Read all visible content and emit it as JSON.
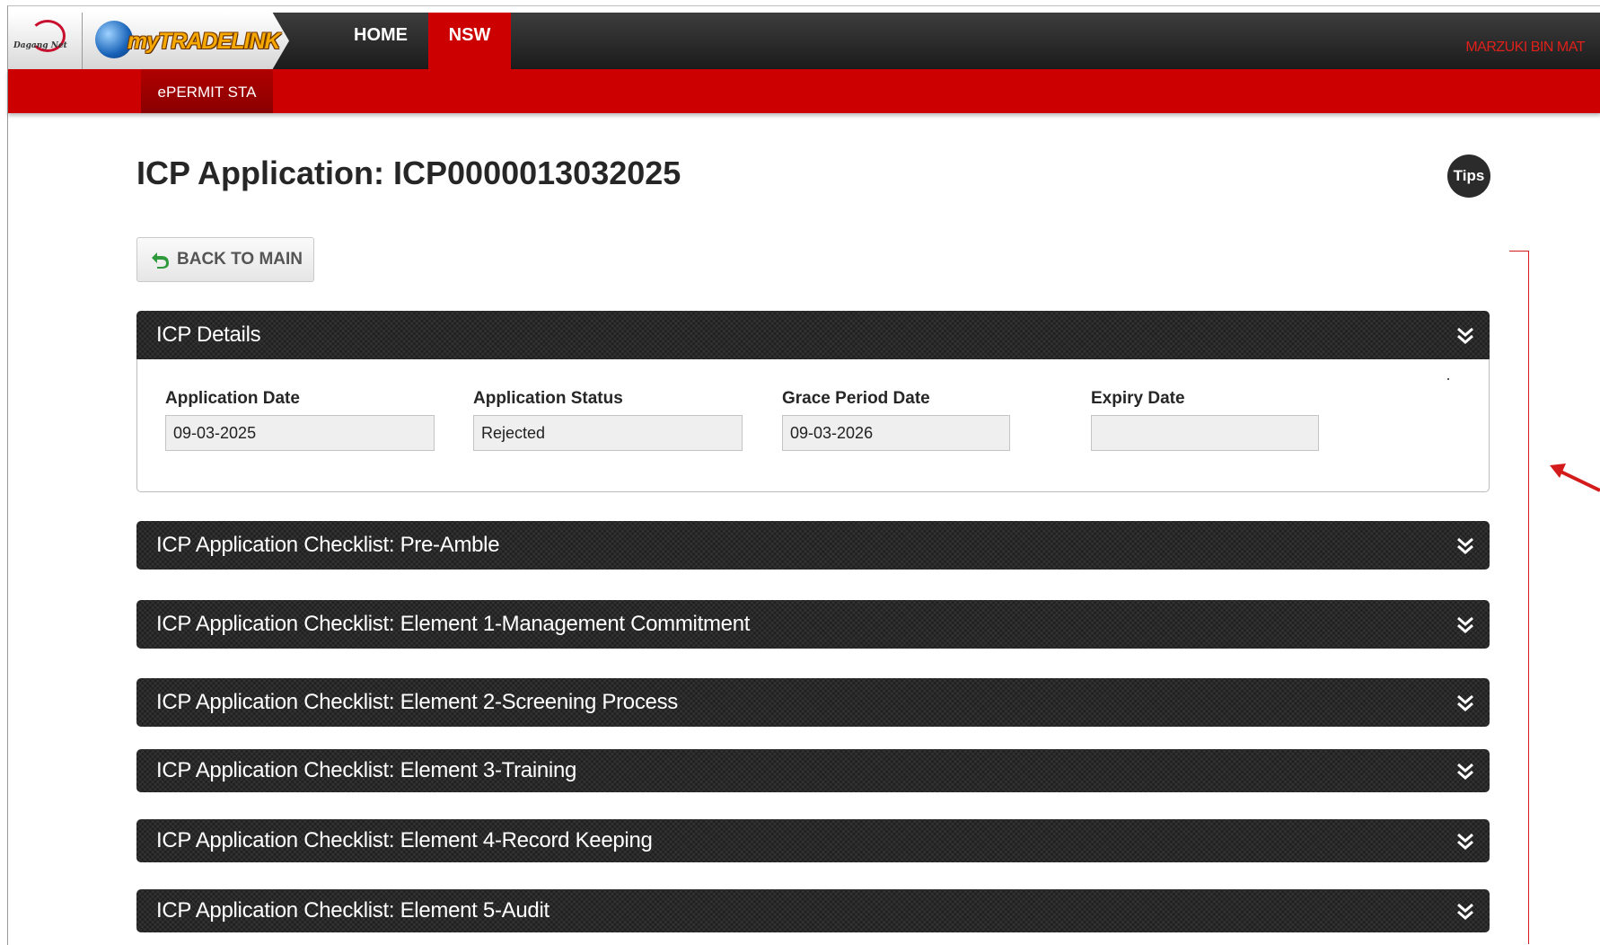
{
  "header": {
    "logo1_text": "Dagang Net",
    "brand": "myTRADELINK",
    "nav": [
      "HOME",
      "NSW"
    ],
    "user": "MARZUKI BIN MAT",
    "subtab": "ePERMIT STA"
  },
  "page": {
    "title": "ICP Application: ICP0000013032025",
    "tips_label": "Tips",
    "back_label": "BACK TO MAIN"
  },
  "details": {
    "header": "ICP Details",
    "fields": [
      {
        "label": "Application Date",
        "value": "09-03-2025"
      },
      {
        "label": "Application Status",
        "value": "Rejected"
      },
      {
        "label": "Grace Period Date",
        "value": "09-03-2026"
      },
      {
        "label": "Expiry Date",
        "value": ""
      }
    ]
  },
  "sections": [
    "ICP Application Checklist: Pre-Amble",
    "ICP Application Checklist: Element 1-Management Commitment",
    "ICP Application Checklist: Element 2-Screening Process",
    "ICP Application Checklist: Element 3-Training",
    "ICP Application Checklist: Element 4-Record Keeping",
    "ICP Application Checklist: Element 5-Audit"
  ],
  "colors": {
    "brand_red": "#cc0000",
    "nav_dark": "#1b1b1b",
    "annotation_red": "#d31b1b",
    "brand_yellow": "#f5a800"
  }
}
